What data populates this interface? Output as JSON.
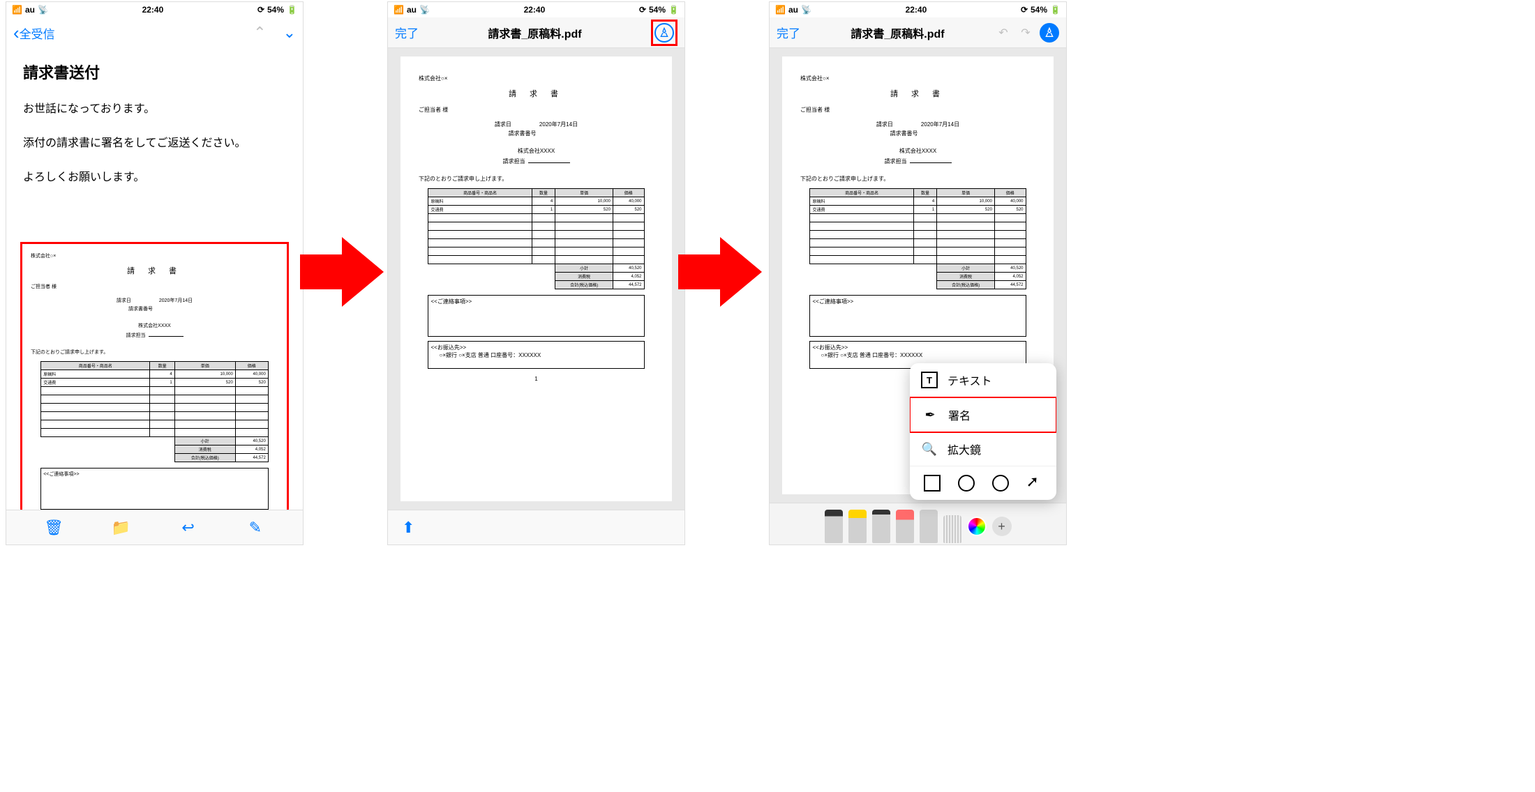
{
  "statusbar": {
    "carrier": "au",
    "time": "22:40",
    "battery": "54%"
  },
  "mail": {
    "back_label": "全受信",
    "subject": "請求書送付",
    "line1": "お世話になっております。",
    "line2": "添付の請求書に署名をしてご返送ください。",
    "line3": "よろしくお願いします。"
  },
  "pdf": {
    "done": "完了",
    "filename": "請求書_原稿料.pdf"
  },
  "invoice": {
    "company_from": "株式会社○×",
    "recipient": "ご担当者 様",
    "title": "請 求 書",
    "date_label": "請求日",
    "date": "2020年7月14日",
    "number_label": "請求書番号",
    "client": "株式会社XXXX",
    "client_pic_label": "請求担当",
    "intro": "下記のとおりご請求申し上げます。",
    "headers": {
      "name": "商品番号・商品名",
      "qty": "数量",
      "price": "単価",
      "amount": "価格"
    },
    "rows": [
      {
        "name": "原稿料",
        "qty": "4",
        "price": "10,000",
        "amount": "40,000"
      },
      {
        "name": "交通費",
        "qty": "1",
        "price": "520",
        "amount": "520"
      }
    ],
    "subtotal_label": "小計",
    "subtotal": "40,520",
    "tax_label": "消費税",
    "tax": "4,052",
    "total_label": "合計(税込価格)",
    "total": "44,572",
    "note_title": "<<ご連絡事項>>",
    "bank_title": "<<お振込先>>",
    "bank_info": "○×銀行 ○×支店 普通 口座番号：XXXXXX",
    "pagenum": "1"
  },
  "popup": {
    "text": "テキスト",
    "signature": "署名",
    "magnifier": "拡大鏡"
  }
}
